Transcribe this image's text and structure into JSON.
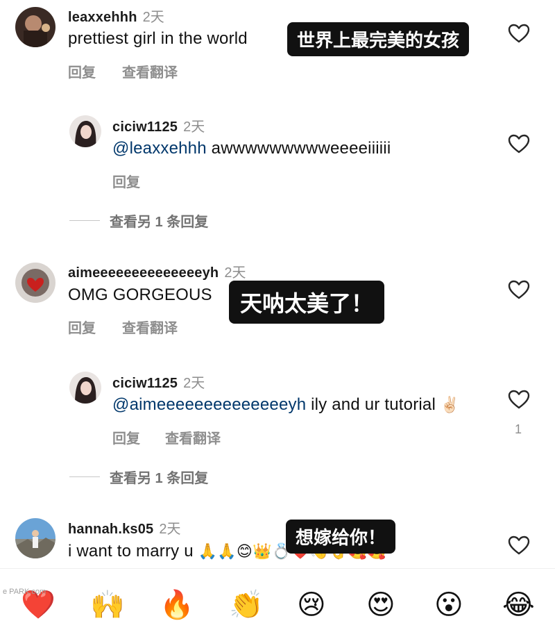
{
  "comments": [
    {
      "username": "leaxxehhh",
      "time": "2天",
      "text": "prettiest girl in the world",
      "subtitle": "世界上最完美的女孩",
      "reply_label": "回复",
      "translate_label": "查看翻译",
      "reply": {
        "username": "ciciw1125",
        "time": "2天",
        "mention": "@leaxxehhh",
        "text": " awwwwwwwwweeeeiiiiii",
        "reply_label": "回复"
      },
      "view_more": "查看另 1 条回复"
    },
    {
      "username": "aimeeeeeeeeeeeeeeyh",
      "time": "2天",
      "text": "OMG GORGEOUS",
      "subtitle": "天呐太美了！",
      "reply_label": "回复",
      "translate_label": "查看翻译",
      "reply": {
        "username": "ciciw1125",
        "time": "2天",
        "mention": "@aimeeeeeeeeeeeeeeyh",
        "text": " ily and ur tutorial ",
        "text_emoji": "✌🏻",
        "reply_label": "回复",
        "translate_label": "查看翻译",
        "like_count": "1"
      },
      "view_more": "查看另 1 条回复"
    },
    {
      "username": "hannah.ks05",
      "time": "2天",
      "text": "i want to marry u ",
      "text_emoji": "🙏🙏😊👑💍❤️👋👌🥰🥰",
      "subtitle": "想嫁给你！"
    }
  ],
  "emoji_bar": [
    "❤️",
    "🙌",
    "🔥",
    "👏",
    "😢",
    "😍",
    "😮",
    "😂"
  ],
  "watermark": "e PARK.com",
  "icons": {
    "like": "heart-outline-icon",
    "text_color": "#111111",
    "muted_color": "#8e8e8e",
    "mention_color": "#00376b",
    "subtitle_bg": "#111111"
  }
}
